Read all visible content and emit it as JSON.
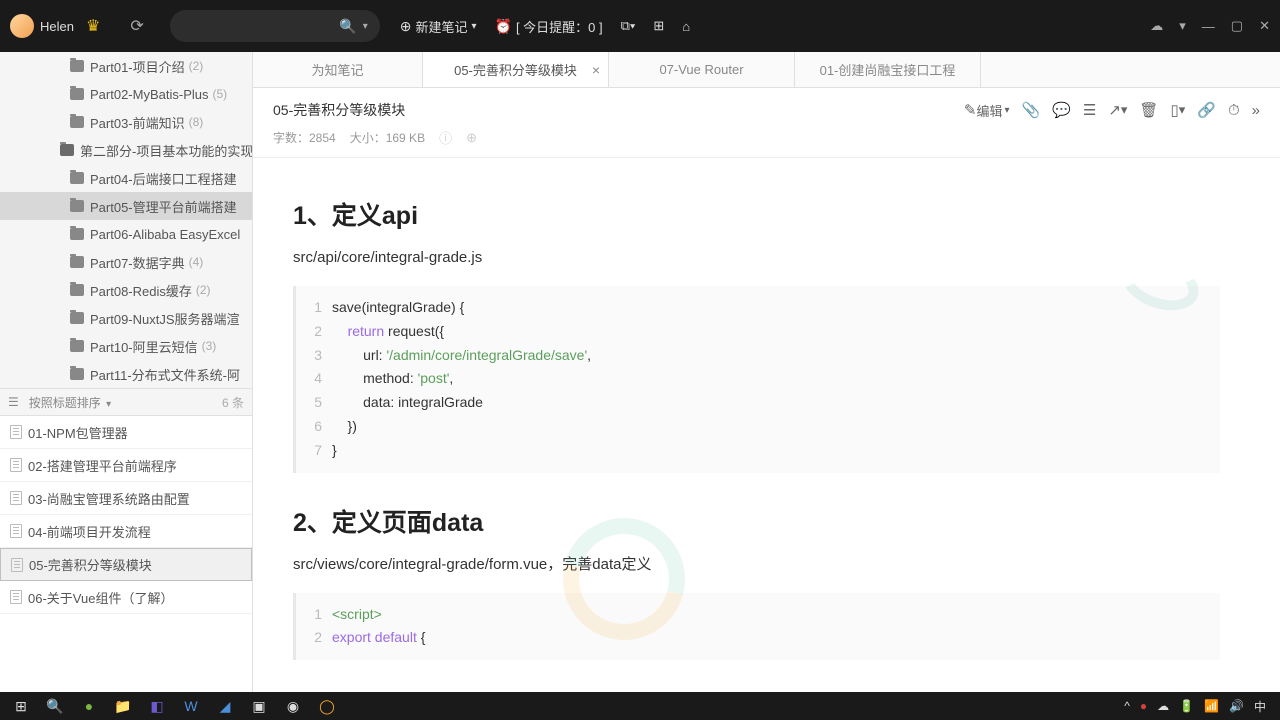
{
  "titlebar": {
    "username": "Helen",
    "new_note": "新建笔记",
    "reminder": "[ 今日提醒：0 ]"
  },
  "tree": [
    {
      "label": "Part01-项目介绍",
      "count": "(2)",
      "lvl": 2
    },
    {
      "label": "Part02-MyBatis-Plus",
      "count": "(5)",
      "lvl": 2
    },
    {
      "label": "Part03-前端知识",
      "count": "(8)",
      "lvl": 2
    },
    {
      "label": "第二部分-项目基本功能的实现",
      "count": "",
      "lvl": 1
    },
    {
      "label": "Part04-后端接口工程搭建",
      "count": "",
      "lvl": 2
    },
    {
      "label": "Part05-管理平台前端搭建",
      "count": "",
      "lvl": 2,
      "selected": true
    },
    {
      "label": "Part06-Alibaba EasyExcel",
      "count": "",
      "lvl": 2
    },
    {
      "label": "Part07-数据字典",
      "count": "(4)",
      "lvl": 2
    },
    {
      "label": "Part08-Redis缓存",
      "count": "(2)",
      "lvl": 2
    },
    {
      "label": "Part09-NuxtJS服务器端渲",
      "count": "",
      "lvl": 2
    },
    {
      "label": "Part10-阿里云短信",
      "count": "(3)",
      "lvl": 2
    },
    {
      "label": "Part11-分布式文件系统-阿",
      "count": "",
      "lvl": 2
    }
  ],
  "list_header": {
    "sort_label": "按照标题排序",
    "count": "6 条"
  },
  "notes": [
    {
      "title": "01-NPM包管理器"
    },
    {
      "title": "02-搭建管理平台前端程序"
    },
    {
      "title": "03-尚融宝管理系统路由配置"
    },
    {
      "title": "04-前端项目开发流程"
    },
    {
      "title": "05-完善积分等级模块",
      "selected": true
    },
    {
      "title": "06-关于Vue组件（了解）"
    }
  ],
  "tabs": [
    {
      "label": "为知笔记"
    },
    {
      "label": "05-完善积分等级模块",
      "active": true,
      "closable": true
    },
    {
      "label": "07-Vue Router"
    },
    {
      "label": "01-创建尚融宝接口工程"
    }
  ],
  "note": {
    "title": "05-完善积分等级模块",
    "edit_btn": "编辑",
    "char_count": "字数：2854",
    "size": "大小：169 KB"
  },
  "doc": {
    "h1": "1、定义api",
    "p1": "src/api/core/integral-grade.js",
    "code1": [
      {
        "ln": "1",
        "pre": "save(integralGrade) {"
      },
      {
        "ln": "2",
        "pre": "    ",
        "kw": "return",
        "post": " request({"
      },
      {
        "ln": "3",
        "pre": "        url: ",
        "str": "'/admin/core/integralGrade/save'",
        "post": ","
      },
      {
        "ln": "4",
        "pre": "        method: ",
        "str": "'post'",
        "post": ","
      },
      {
        "ln": "5",
        "pre": "        data: integralGrade"
      },
      {
        "ln": "6",
        "pre": "    })"
      },
      {
        "ln": "7",
        "pre": "}"
      }
    ],
    "h2": "2、定义页面data",
    "p2": "src/views/core/integral-grade/form.vue，完善data定义",
    "code2": [
      {
        "ln": "1",
        "tag": "<script>"
      },
      {
        "ln": "2",
        "kw": "export default",
        "post": " {"
      }
    ]
  },
  "tray": {
    "ime": "中"
  }
}
